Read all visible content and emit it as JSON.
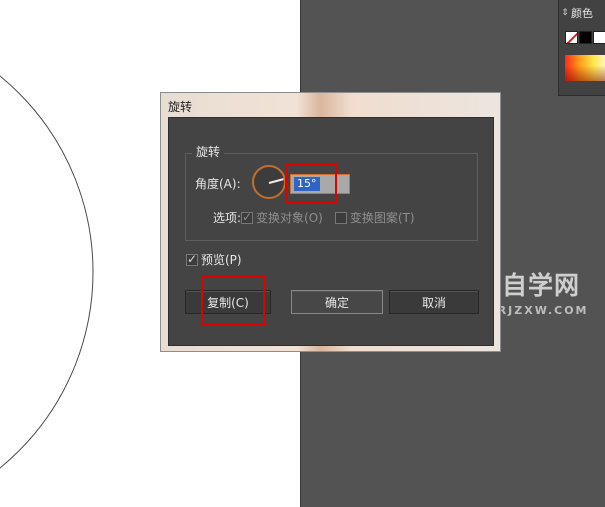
{
  "panel": {
    "title": "颜色",
    "collapse_icon": "updown-arrows-icon"
  },
  "dialog": {
    "title": "旋转",
    "group_label": "旋转",
    "angle_label": "角度(A):",
    "angle_value": "15°",
    "angle_degrees": 15,
    "options_label": "选项:",
    "transform_objects": "变换对象(O)",
    "transform_patterns": "变换图案(T)",
    "preview": "预览(P)",
    "copy_button": "复制(C)",
    "ok_button": "确定",
    "cancel_button": "取消"
  },
  "watermark": {
    "text": "软件自学网",
    "url": "WWW.RJZXW.COM"
  },
  "colors": {
    "highlight": "#e00000",
    "accent": "#c26f2e",
    "selection": "#2f63c4"
  }
}
